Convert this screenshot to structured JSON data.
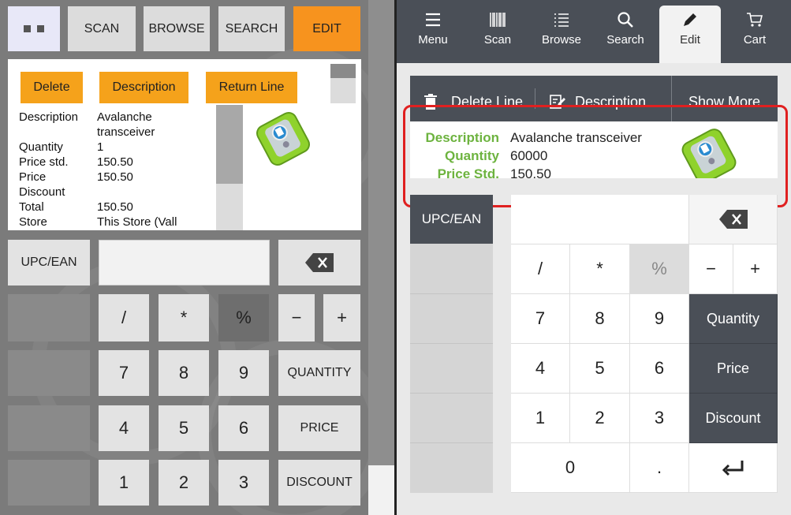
{
  "left": {
    "topbar": {
      "scan": "SCAN",
      "browse": "BROWSE",
      "search": "SEARCH",
      "edit": "EDIT"
    },
    "actions": {
      "delete": "Delete",
      "description": "Description",
      "return_line": "Return Line"
    },
    "details": [
      {
        "label": "Description",
        "value": "Avalanche\ntransceiver"
      },
      {
        "label": "Quantity",
        "value": "1"
      },
      {
        "label": "Price std.",
        "value": "150.50"
      },
      {
        "label": "Price\nDiscount",
        "value": "150.50"
      },
      {
        "label": "Total",
        "value": "150.50"
      },
      {
        "label": "Store",
        "value": "This Store (Vall"
      }
    ],
    "keypad": {
      "upc": "UPC/EAN",
      "slash": "/",
      "star": "*",
      "percent": "%",
      "minus": "−",
      "plus": "+",
      "n7": "7",
      "n8": "8",
      "n9": "9",
      "quantity": "QUANTITY",
      "n4": "4",
      "n5": "5",
      "n6": "6",
      "price": "PRICE",
      "n1": "1",
      "n2": "2",
      "n3": "3",
      "discount": "DISCOUNT"
    }
  },
  "right": {
    "nav": {
      "menu": "Menu",
      "scan": "Scan",
      "browse": "Browse",
      "search": "Search",
      "edit": "Edit",
      "cart": "Cart"
    },
    "bar": {
      "delete_line": "Delete Line",
      "description": "Description",
      "show_more": "Show More"
    },
    "card": [
      {
        "label": "Description",
        "value": "Avalanche transceiver"
      },
      {
        "label": "Quantity",
        "value": "60000"
      },
      {
        "label": "Price Std.",
        "value": "150.50"
      }
    ],
    "keypad": {
      "upc": "UPC/EAN",
      "slash": "/",
      "star": "*",
      "percent": "%",
      "minus": "−",
      "plus": "+",
      "n7": "7",
      "n8": "8",
      "n9": "9",
      "quantity": "Quantity",
      "n4": "4",
      "n5": "5",
      "n6": "6",
      "price": "Price",
      "n1": "1",
      "n2": "2",
      "n3": "3",
      "discount": "Discount",
      "n0": "0",
      "dot": "."
    }
  },
  "colors": {
    "accent_orange": "#f7931e",
    "nav_dark": "#4a4f57",
    "label_green": "#6db33f",
    "highlight_red": "#e02020"
  }
}
